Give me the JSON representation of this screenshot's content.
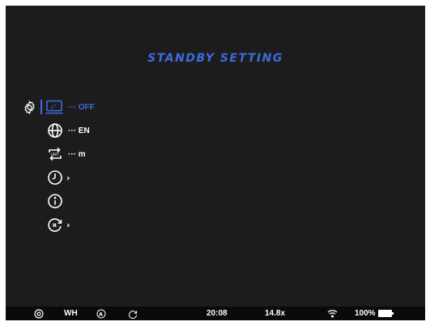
{
  "screen": {
    "title": "STANDBY SETTING",
    "accent_color": "#3b6dd8",
    "background_color": "#1c1c1f"
  },
  "menu": {
    "selected_icon": "gear-icon",
    "items": [
      {
        "icon": "sleep-timer-icon",
        "value": "··· OFF",
        "active": true
      },
      {
        "icon": "globe-icon",
        "value": "··· EN",
        "active": false
      },
      {
        "icon": "unit-switch-icon",
        "value": "··· m",
        "active": false
      },
      {
        "icon": "clock-icon",
        "value": "›",
        "active": false
      },
      {
        "icon": "info-icon",
        "value": "",
        "active": false
      },
      {
        "icon": "reset-icon",
        "value": "›",
        "active": false
      }
    ]
  },
  "status_bar": {
    "mode": "WH",
    "time": "20:08",
    "zoom": "14.8x",
    "battery": "100%",
    "icons": [
      "eye-icon",
      "auto-mode-icon",
      "auto-off-icon",
      "wifi-icon",
      "battery-icon"
    ]
  }
}
